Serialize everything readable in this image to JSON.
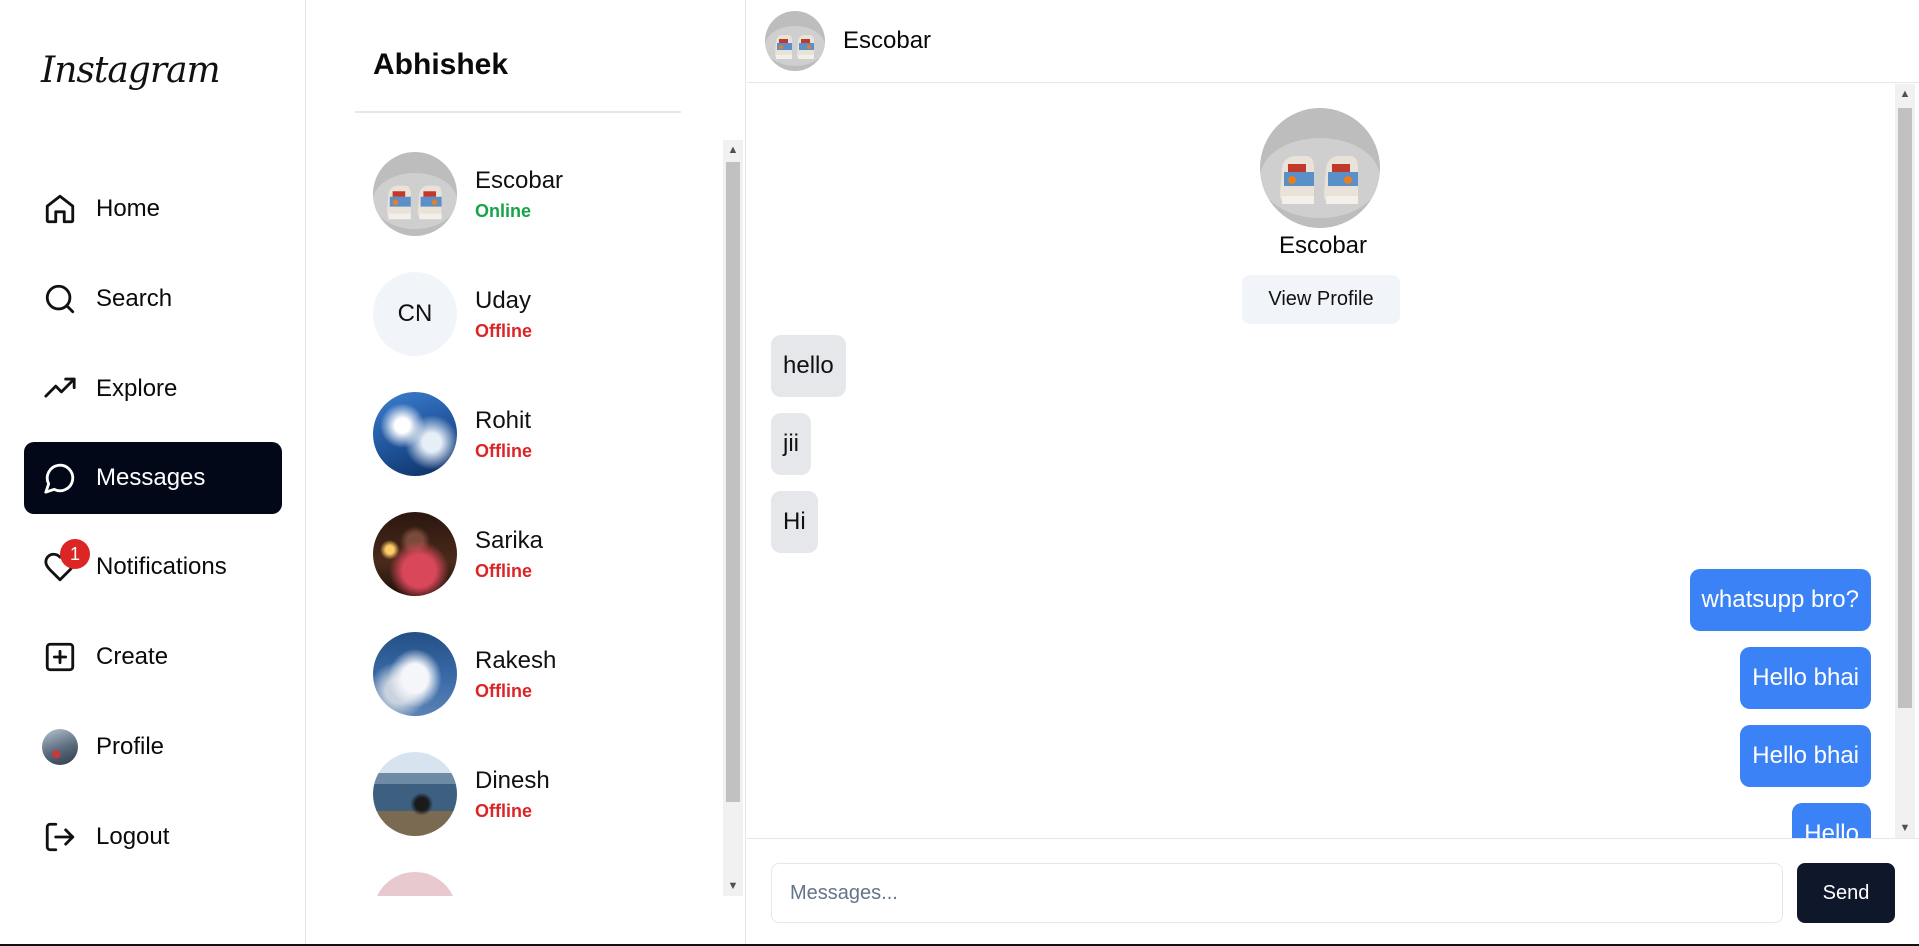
{
  "brand": {
    "logo": "Instagram"
  },
  "sidebar": {
    "items": [
      {
        "label": "Home",
        "icon": "home-icon",
        "active": false
      },
      {
        "label": "Search",
        "icon": "search-icon",
        "active": false
      },
      {
        "label": "Explore",
        "icon": "trending-up-icon",
        "active": false
      },
      {
        "label": "Messages",
        "icon": "message-circle-icon",
        "active": true
      },
      {
        "label": "Notifications",
        "icon": "heart-icon",
        "active": false,
        "badge": "1"
      },
      {
        "label": "Create",
        "icon": "plus-square-icon",
        "active": false
      },
      {
        "label": "Profile",
        "icon": "avatar-icon",
        "active": false
      },
      {
        "label": "Logout",
        "icon": "logout-icon",
        "active": false
      }
    ]
  },
  "conversations": {
    "title": "Abhishek",
    "items": [
      {
        "name": "Escobar",
        "status": "Online",
        "avatar": "shoes-photo"
      },
      {
        "name": "Uday",
        "status": "Offline",
        "avatar_initials": "CN"
      },
      {
        "name": "Rohit",
        "status": "Offline",
        "avatar": "sky-photo"
      },
      {
        "name": "Sarika",
        "status": "Offline",
        "avatar": "candle-photo"
      },
      {
        "name": "Rakesh",
        "status": "Offline",
        "avatar": "clouds-photo"
      },
      {
        "name": "Dinesh",
        "status": "Offline",
        "avatar": "lake-photo"
      }
    ]
  },
  "chat": {
    "header_name": "Escobar",
    "profile_name": "Escobar",
    "view_profile_label": "View Profile",
    "messages": [
      {
        "text": "hello",
        "direction": "in"
      },
      {
        "text": "jii",
        "direction": "in"
      },
      {
        "text": "Hi",
        "direction": "in"
      },
      {
        "text": "whatsupp bro?",
        "direction": "out"
      },
      {
        "text": "Hello bhai",
        "direction": "out"
      },
      {
        "text": "Hello bhai",
        "direction": "out"
      },
      {
        "text": "Hello",
        "direction": "out"
      }
    ],
    "input_placeholder": "Messages...",
    "send_label": "Send"
  },
  "colors": {
    "active_nav": "#020817",
    "online": "#16a34a",
    "offline": "#dc2626",
    "outgoing_bubble": "#3b82f6",
    "incoming_bubble": "#e5e7eb",
    "send_button": "#0f172a"
  }
}
